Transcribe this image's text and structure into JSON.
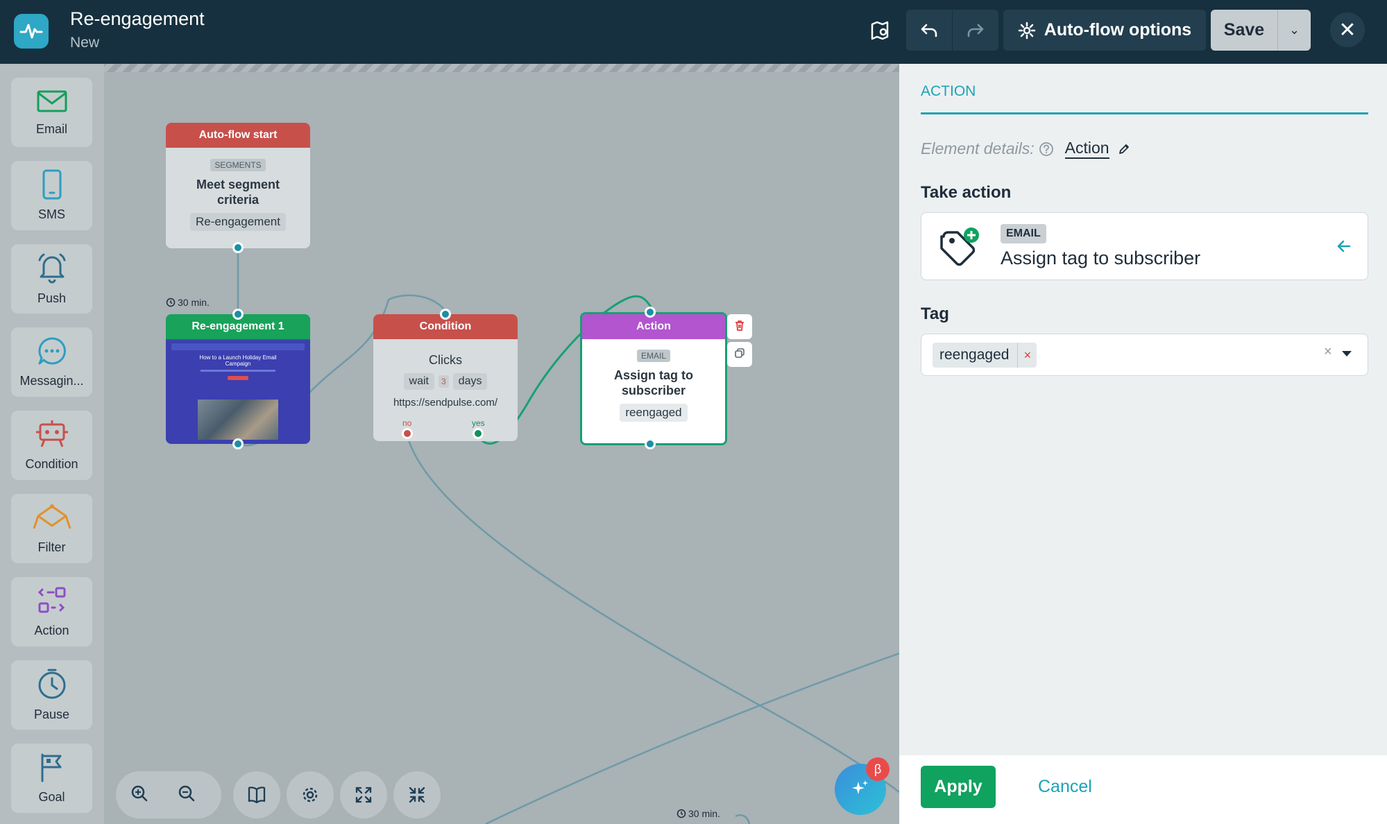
{
  "header": {
    "title": "Re-engagement",
    "subtitle": "New",
    "options_label": "Auto-flow options",
    "save_label": "Save"
  },
  "palette": [
    {
      "label": "Email",
      "icon": "envelope-icon"
    },
    {
      "label": "SMS",
      "icon": "phone-icon"
    },
    {
      "label": "Push",
      "icon": "bell-icon"
    },
    {
      "label": "Messagin...",
      "icon": "chat-icon"
    },
    {
      "label": "Condition",
      "icon": "condition-icon"
    },
    {
      "label": "Filter",
      "icon": "filter-icon"
    },
    {
      "label": "Action",
      "icon": "action-icon"
    },
    {
      "label": "Pause",
      "icon": "clock-icon"
    },
    {
      "label": "Goal",
      "icon": "flag-icon"
    }
  ],
  "nodes": {
    "start": {
      "header": "Auto-flow start",
      "chip": "SEGMENTS",
      "text": "Meet segment criteria",
      "tag": "Re-engagement"
    },
    "email": {
      "header": "Re-engagement 1",
      "delay": "30 min.",
      "preview_heading": "How to a Launch Holiday Email Campaign"
    },
    "condition": {
      "header": "Condition",
      "text": "Clicks",
      "wait_label": "wait",
      "wait_value": "3",
      "wait_unit": "days",
      "url": "https://sendpulse.com/",
      "no_label": "no",
      "yes_label": "yes"
    },
    "action": {
      "header": "Action",
      "chip": "EMAIL",
      "text": "Assign tag to subscriber",
      "tag": "reengaged"
    },
    "offscreen_delay": "30 min."
  },
  "beta_label": "β",
  "panel": {
    "tab": "ACTION",
    "element_details_label": "Element details:",
    "element_name": "Action",
    "take_action_title": "Take action",
    "action_category": "EMAIL",
    "action_text": "Assign tag to subscriber",
    "tag_title": "Tag",
    "tag_value": "reengaged",
    "apply_label": "Apply",
    "cancel_label": "Cancel"
  },
  "colors": {
    "topbar": "#16303f",
    "start_header": "#c7504b",
    "email_header": "#18a25a",
    "condition_header": "#c7504b",
    "action_header": "#b255cf",
    "accent": "#1ba3b8",
    "apply": "#10a25f"
  }
}
